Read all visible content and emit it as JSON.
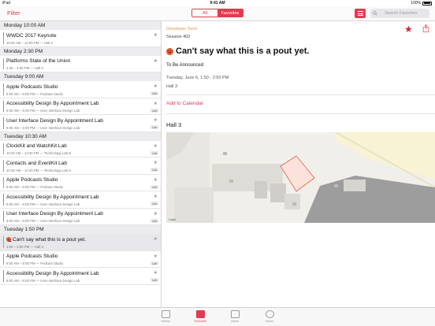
{
  "status": {
    "device": "iPad",
    "time": "9:41 AM",
    "battery": "100%"
  },
  "nav": {
    "filter_label": "Filter",
    "segments": [
      {
        "label": "All",
        "selected": false
      },
      {
        "label": "Favorites",
        "selected": true
      }
    ],
    "search_placeholder": "Search Favorites",
    "accent": "#e23b4e"
  },
  "schedule": [
    {
      "header": "Monday 10:00 AM",
      "sessions": [
        {
          "title": "WWDC 2017 Keynote",
          "sub": "10:00 AM – 12:00 PM — Hall 3",
          "color": "#9b9ba0",
          "badge": ""
        }
      ]
    },
    {
      "header": "Monday 2:30 PM",
      "sessions": [
        {
          "title": "Platforms State of the Union",
          "sub": "2:30 – 4:00 PM — Hall 3",
          "color": "#9b9ba0",
          "badge": ""
        }
      ]
    },
    {
      "header": "Tuesday 9:00 AM",
      "sessions": [
        {
          "title": "Apple Podcasts Studio",
          "sub": "9:00 AM – 6:00 PM — Podcast Studio",
          "color": "#9b9ba0",
          "badge": "Lab"
        },
        {
          "title": "Accessibility Design By Appointment Lab",
          "sub": "9:00 AM – 6:00 PM — User Interface Design Lab",
          "color": "#37b3b0",
          "badge": "Lab"
        },
        {
          "title": "User Interface Design By Appointment Lab",
          "sub": "9:00 AM – 6:00 PM — User Interface Design Lab",
          "color": "#37b3b0",
          "badge": "Lab"
        }
      ]
    },
    {
      "header": "Tuesday 10:30 AM",
      "sessions": [
        {
          "title": "ClockKit and WatchKit Lab",
          "sub": "10:30 AM – 12:30 PM — Technology Lab B",
          "color": "#9b9ba0",
          "badge": "Lab"
        },
        {
          "title": "Contacts and EventKit Lab",
          "sub": "10:30 AM – 12:30 PM — Technology Lab H",
          "color": "#9b9ba0",
          "badge": "Lab"
        },
        {
          "title": "Apple Podcasts Studio",
          "sub": "9:00 AM – 6:00 PM — Podcast Studio",
          "color": "#9b9ba0",
          "badge": "Lab"
        },
        {
          "title": "Accessibility Design By Appointment Lab",
          "sub": "9:00 AM – 6:00 PM — User Interface Design Lab",
          "color": "#37b3b0",
          "badge": "Lab"
        },
        {
          "title": "User Interface Design By Appointment Lab",
          "sub": "9:00 AM – 6:00 PM — User Interface Design Lab",
          "color": "#37b3b0",
          "badge": "Lab"
        }
      ]
    },
    {
      "header": "Tuesday 1:50 PM",
      "sessions": [
        {
          "title": "Can't say what this is a pout yet.",
          "sub": "1:50 – 2:50 PM — Hall 3",
          "color": "#e8954a",
          "badge": "",
          "emoji": true,
          "selected": true
        },
        {
          "title": "Apple Podcasts Studio",
          "sub": "9:00 AM – 6:00 PM — Podcast Studio",
          "color": "#9b9ba0",
          "badge": "Lab"
        },
        {
          "title": "Accessibility Design By Appointment Lab",
          "sub": "9:00 AM – 6:00 PM — User Interface Design Lab",
          "color": "#37b3b0",
          "badge": "Lab"
        }
      ]
    }
  ],
  "detail": {
    "track": "Developer Tools",
    "session": "Session 402",
    "title": "Can't say what this is a pout yet.",
    "tba": "To Be Announced",
    "time": "Tuesday, June 6, 1:50 - 2:50 PM",
    "room": "Hall 3",
    "add_calendar": "Add to Calendar",
    "hall_heading": "Hall 3",
    "map_legal": "Legal",
    "favorite_icon": "star-filled-icon",
    "share_icon": "share-icon"
  },
  "tabs": [
    {
      "label": "Videos",
      "icon": "tv-icon",
      "active": false
    },
    {
      "label": "Schedule",
      "icon": "calendar-icon",
      "active": true
    },
    {
      "label": "News",
      "icon": "news-icon",
      "active": false
    },
    {
      "label": "Venue",
      "icon": "location-icon",
      "active": false
    }
  ]
}
